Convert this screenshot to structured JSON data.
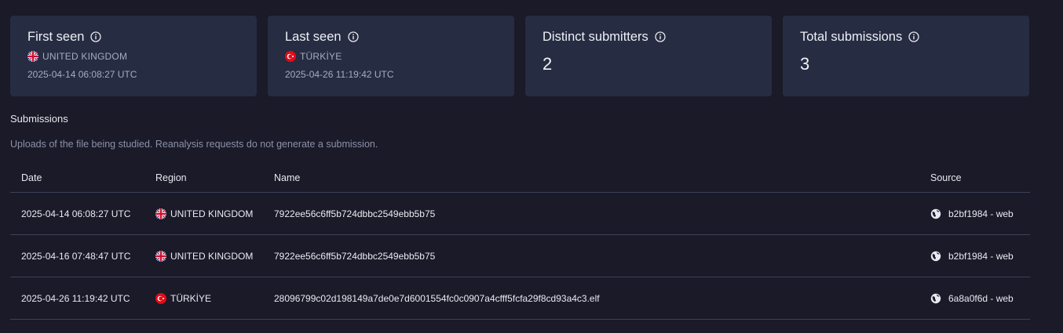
{
  "cards": [
    {
      "title": "First seen",
      "country": "UNITED KINGDOM",
      "flag": "uk-flag-icon",
      "date": "2025-04-14 06:08:27 UTC"
    },
    {
      "title": "Last seen",
      "country": "TÜRKİYE",
      "flag": "turkey-flag-icon",
      "date": "2025-04-26 11:19:42 UTC"
    },
    {
      "title": "Distinct submitters",
      "value": "2"
    },
    {
      "title": "Total submissions",
      "value": "3"
    }
  ],
  "submissions": {
    "title": "Submissions",
    "description": "Uploads of the file being studied. Reanalysis requests do not generate a submission.",
    "columns": [
      "Date",
      "Region",
      "Name",
      "Source"
    ],
    "rows": [
      {
        "date": "2025-04-14 06:08:27 UTC",
        "region": "UNITED KINGDOM",
        "flag": "uk-flag-icon",
        "name": "7922ee56c6ff5b724dbbc2549ebb5b75",
        "source": "b2bf1984 - web"
      },
      {
        "date": "2025-04-16 07:48:47 UTC",
        "region": "UNITED KINGDOM",
        "flag": "uk-flag-icon",
        "name": "7922ee56c6ff5b724dbbc2549ebb5b75",
        "source": "b2bf1984 - web"
      },
      {
        "date": "2025-04-26 11:19:42 UTC",
        "region": "TÜRKİYE",
        "flag": "turkey-flag-icon",
        "name": "28096799c02d198149a7de0e7d6001554fc0c0907a4cfff5fcfa29f8cd93a4c3.elf",
        "source": "6a8a0f6d - web"
      }
    ]
  },
  "colors": {
    "background": "#1a1a28",
    "card": "#262c42",
    "muted": "#a7acbd",
    "divider": "#3d4258"
  }
}
